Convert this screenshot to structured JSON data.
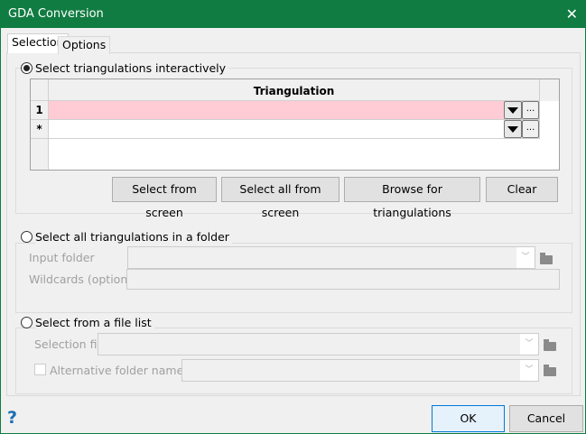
{
  "window": {
    "title": "GDA Conversion"
  },
  "tabs": [
    {
      "label": "Selection",
      "active": true
    },
    {
      "label": "Options",
      "active": false
    }
  ],
  "group_interactive": {
    "label": "Select triangulations interactively",
    "selected": true,
    "grid": {
      "column_header": "Triangulation",
      "rows": [
        {
          "marker": "1",
          "value": ""
        },
        {
          "marker": "*",
          "value": ""
        }
      ]
    },
    "buttons": [
      "Select from screen",
      "Select all from screen",
      "Browse for triangulations",
      "Clear"
    ]
  },
  "group_folder": {
    "label": "Select all triangulations in a folder",
    "selected": false,
    "input_folder_label": "Input folder",
    "input_folder_value": "",
    "wildcards_label": "Wildcards (optional)",
    "wildcards_value": ""
  },
  "group_filelist": {
    "label": "Select from a file list",
    "selected": false,
    "selection_file_label": "Selection file",
    "alt_folder_label": "Alternative folder name",
    "alt_folder_checked": false
  },
  "footer": {
    "ok": "OK",
    "cancel": "Cancel",
    "help": "?"
  },
  "colors": {
    "titlebar": "#107c41",
    "row_highlight": "#ffccd5",
    "help": "#1a6fb5"
  }
}
